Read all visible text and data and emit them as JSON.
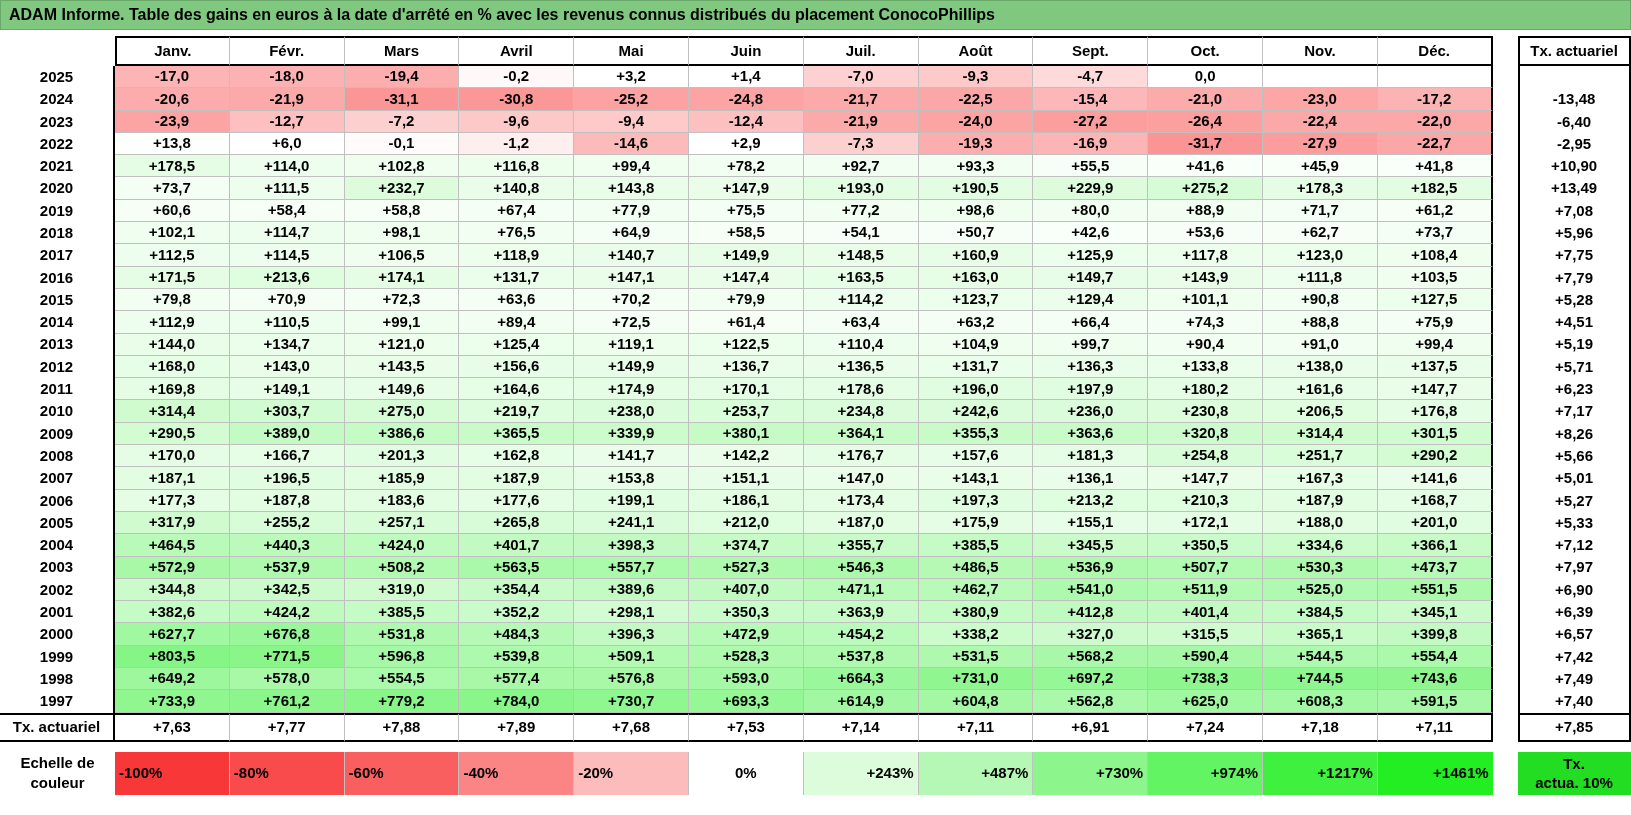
{
  "title": "ADAM Informe. Table des gains en euros à la date d'arrêté en % avec les revenus connus distribués du placement ConocoPhillips",
  "columns": [
    "Janv.",
    "Févr.",
    "Mars",
    "Avril",
    "Mai",
    "Juin",
    "Juil.",
    "Août",
    "Sept.",
    "Oct.",
    "Nov.",
    "Déc."
  ],
  "tx_header": "Tx. actuariel",
  "rows": [
    {
      "year": "2025",
      "values": [
        "-17,0",
        "-18,0",
        "-19,4",
        "-0,2",
        "+3,2",
        "+1,4",
        "-7,0",
        "-9,3",
        "-4,7",
        "0,0"
      ]
    },
    {
      "year": "2024",
      "values": [
        "-20,6",
        "-21,9",
        "-31,1",
        "-30,8",
        "-25,2",
        "-24,8",
        "-21,7",
        "-22,5",
        "-15,4",
        "-21,0",
        "-23,0",
        "-17,2"
      ],
      "tx": "-13,48"
    },
    {
      "year": "2023",
      "values": [
        "-23,9",
        "-12,7",
        "-7,2",
        "-9,6",
        "-9,4",
        "-12,4",
        "-21,9",
        "-24,0",
        "-27,2",
        "-26,4",
        "-22,4",
        "-22,0"
      ],
      "tx": "-6,40"
    },
    {
      "year": "2022",
      "values": [
        "+13,8",
        "+6,0",
        "-0,1",
        "-1,2",
        "-14,6",
        "+2,9",
        "-7,3",
        "-19,3",
        "-16,9",
        "-31,7",
        "-27,9",
        "-22,7"
      ],
      "tx": "-2,95"
    },
    {
      "year": "2021",
      "values": [
        "+178,5",
        "+114,0",
        "+102,8",
        "+116,8",
        "+99,4",
        "+78,2",
        "+92,7",
        "+93,3",
        "+55,5",
        "+41,6",
        "+45,9",
        "+41,8"
      ],
      "tx": "+10,90"
    },
    {
      "year": "2020",
      "values": [
        "+73,7",
        "+111,5",
        "+232,7",
        "+140,8",
        "+143,8",
        "+147,9",
        "+193,0",
        "+190,5",
        "+229,9",
        "+275,2",
        "+178,3",
        "+182,5"
      ],
      "tx": "+13,49"
    },
    {
      "year": "2019",
      "values": [
        "+60,6",
        "+58,4",
        "+58,8",
        "+67,4",
        "+77,9",
        "+75,5",
        "+77,2",
        "+98,6",
        "+80,0",
        "+88,9",
        "+71,7",
        "+61,2"
      ],
      "tx": "+7,08"
    },
    {
      "year": "2018",
      "values": [
        "+102,1",
        "+114,7",
        "+98,1",
        "+76,5",
        "+64,9",
        "+58,5",
        "+54,1",
        "+50,7",
        "+42,6",
        "+53,6",
        "+62,7",
        "+73,7"
      ],
      "tx": "+5,96"
    },
    {
      "year": "2017",
      "values": [
        "+112,5",
        "+114,5",
        "+106,5",
        "+118,9",
        "+140,7",
        "+149,9",
        "+148,5",
        "+160,9",
        "+125,9",
        "+117,8",
        "+123,0",
        "+108,4"
      ],
      "tx": "+7,75"
    },
    {
      "year": "2016",
      "values": [
        "+171,5",
        "+213,6",
        "+174,1",
        "+131,7",
        "+147,1",
        "+147,4",
        "+163,5",
        "+163,0",
        "+149,7",
        "+143,9",
        "+111,8",
        "+103,5"
      ],
      "tx": "+7,79"
    },
    {
      "year": "2015",
      "values": [
        "+79,8",
        "+70,9",
        "+72,3",
        "+63,6",
        "+70,2",
        "+79,9",
        "+114,2",
        "+123,7",
        "+129,4",
        "+101,1",
        "+90,8",
        "+127,5"
      ],
      "tx": "+5,28"
    },
    {
      "year": "2014",
      "values": [
        "+112,9",
        "+110,5",
        "+99,1",
        "+89,4",
        "+72,5",
        "+61,4",
        "+63,4",
        "+63,2",
        "+66,4",
        "+74,3",
        "+88,8",
        "+75,9"
      ],
      "tx": "+4,51"
    },
    {
      "year": "2013",
      "values": [
        "+144,0",
        "+134,7",
        "+121,0",
        "+125,4",
        "+119,1",
        "+122,5",
        "+110,4",
        "+104,9",
        "+99,7",
        "+90,4",
        "+91,0",
        "+99,4"
      ],
      "tx": "+5,19"
    },
    {
      "year": "2012",
      "values": [
        "+168,0",
        "+143,0",
        "+143,5",
        "+156,6",
        "+149,9",
        "+136,7",
        "+136,5",
        "+131,7",
        "+136,3",
        "+133,8",
        "+138,0",
        "+137,5"
      ],
      "tx": "+5,71"
    },
    {
      "year": "2011",
      "values": [
        "+169,8",
        "+149,1",
        "+149,6",
        "+164,6",
        "+174,9",
        "+170,1",
        "+178,6",
        "+196,0",
        "+197,9",
        "+180,2",
        "+161,6",
        "+147,7"
      ],
      "tx": "+6,23"
    },
    {
      "year": "2010",
      "values": [
        "+314,4",
        "+303,7",
        "+275,0",
        "+219,7",
        "+238,0",
        "+253,7",
        "+234,8",
        "+242,6",
        "+236,0",
        "+230,8",
        "+206,5",
        "+176,8"
      ],
      "tx": "+7,17"
    },
    {
      "year": "2009",
      "values": [
        "+290,5",
        "+389,0",
        "+386,6",
        "+365,5",
        "+339,9",
        "+380,1",
        "+364,1",
        "+355,3",
        "+363,6",
        "+320,8",
        "+314,4",
        "+301,5"
      ],
      "tx": "+8,26"
    },
    {
      "year": "2008",
      "values": [
        "+170,0",
        "+166,7",
        "+201,3",
        "+162,8",
        "+141,7",
        "+142,2",
        "+176,7",
        "+157,6",
        "+181,3",
        "+254,8",
        "+251,7",
        "+290,2"
      ],
      "tx": "+5,66"
    },
    {
      "year": "2007",
      "values": [
        "+187,1",
        "+196,5",
        "+185,9",
        "+187,9",
        "+153,8",
        "+151,1",
        "+147,0",
        "+143,1",
        "+136,1",
        "+147,7",
        "+167,3",
        "+141,6"
      ],
      "tx": "+5,01"
    },
    {
      "year": "2006",
      "values": [
        "+177,3",
        "+187,8",
        "+183,6",
        "+177,6",
        "+199,1",
        "+186,1",
        "+173,4",
        "+197,3",
        "+213,2",
        "+210,3",
        "+187,9",
        "+168,7"
      ],
      "tx": "+5,27"
    },
    {
      "year": "2005",
      "values": [
        "+317,9",
        "+255,2",
        "+257,1",
        "+265,8",
        "+241,1",
        "+212,0",
        "+187,0",
        "+175,9",
        "+155,1",
        "+172,1",
        "+188,0",
        "+201,0"
      ],
      "tx": "+5,33"
    },
    {
      "year": "2004",
      "values": [
        "+464,5",
        "+440,3",
        "+424,0",
        "+401,7",
        "+398,3",
        "+374,7",
        "+355,7",
        "+385,5",
        "+345,5",
        "+350,5",
        "+334,6",
        "+366,1"
      ],
      "tx": "+7,12"
    },
    {
      "year": "2003",
      "values": [
        "+572,9",
        "+537,9",
        "+508,2",
        "+563,5",
        "+557,7",
        "+527,3",
        "+546,3",
        "+486,5",
        "+536,9",
        "+507,7",
        "+530,3",
        "+473,7"
      ],
      "tx": "+7,97"
    },
    {
      "year": "2002",
      "values": [
        "+344,8",
        "+342,5",
        "+319,0",
        "+354,4",
        "+389,6",
        "+407,0",
        "+471,1",
        "+462,7",
        "+541,0",
        "+511,9",
        "+525,0",
        "+551,5"
      ],
      "tx": "+6,90"
    },
    {
      "year": "2001",
      "values": [
        "+382,6",
        "+424,2",
        "+385,5",
        "+352,2",
        "+298,1",
        "+350,3",
        "+363,9",
        "+380,9",
        "+412,8",
        "+401,4",
        "+384,5",
        "+345,1"
      ],
      "tx": "+6,39"
    },
    {
      "year": "2000",
      "values": [
        "+627,7",
        "+676,8",
        "+531,8",
        "+484,3",
        "+396,3",
        "+472,9",
        "+454,2",
        "+338,2",
        "+327,0",
        "+315,5",
        "+365,1",
        "+399,8"
      ],
      "tx": "+6,57"
    },
    {
      "year": "1999",
      "values": [
        "+803,5",
        "+771,5",
        "+596,8",
        "+539,8",
        "+509,1",
        "+528,3",
        "+537,8",
        "+531,5",
        "+568,2",
        "+590,4",
        "+544,5",
        "+554,4"
      ],
      "tx": "+7,42"
    },
    {
      "year": "1998",
      "values": [
        "+649,2",
        "+578,0",
        "+554,5",
        "+577,4",
        "+576,8",
        "+593,0",
        "+664,3",
        "+731,0",
        "+697,2",
        "+738,3",
        "+744,5",
        "+743,6"
      ],
      "tx": "+7,49"
    },
    {
      "year": "1997",
      "values": [
        "+733,9",
        "+761,2",
        "+779,2",
        "+784,0",
        "+730,7",
        "+693,3",
        "+614,9",
        "+604,8",
        "+562,8",
        "+625,0",
        "+608,3",
        "+591,5"
      ],
      "tx": "+7,40"
    }
  ],
  "footer": {
    "label": "Tx. actuariel",
    "values": [
      "+7,63",
      "+7,77",
      "+7,88",
      "+7,89",
      "+7,68",
      "+7,53",
      "+7,14",
      "+7,11",
      "+6,91",
      "+7,24",
      "+7,18",
      "+7,11"
    ],
    "tx": "+7,85"
  },
  "legend": {
    "label": "Echelle de couleur",
    "items": [
      {
        "label": "-100%",
        "color": "#f83838"
      },
      {
        "label": "-80%",
        "color": "#f94b4b"
      },
      {
        "label": "-60%",
        "color": "#fa5f5f"
      },
      {
        "label": "-40%",
        "color": "#fb8585"
      },
      {
        "label": "-20%",
        "color": "#fcbcbc"
      },
      {
        "label": "0%",
        "color": "#ffffff"
      },
      {
        "label": "+243%",
        "color": "#dcfcdc"
      },
      {
        "label": "+487%",
        "color": "#b5f8b5"
      },
      {
        "label": "+730%",
        "color": "#8cf58c"
      },
      {
        "label": "+974%",
        "color": "#62f462"
      },
      {
        "label": "+1217%",
        "color": "#3ff03f"
      },
      {
        "label": "+1461%",
        "color": "#22ee22"
      }
    ],
    "tx_box": {
      "lines": [
        "Tx.",
        "actua. 10%"
      ],
      "color": "#22dd22"
    }
  }
}
